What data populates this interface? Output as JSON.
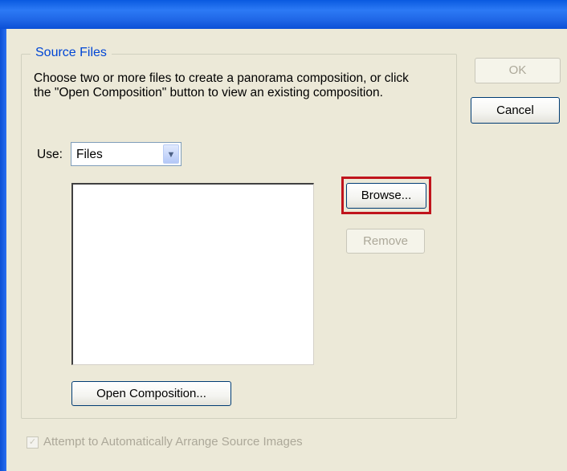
{
  "dialog": {
    "group_title": "Source Files",
    "description_line1": "Choose two or more files to create a panorama composition, or click",
    "description_line2": "the \"Open Composition\" button to view an existing composition.",
    "use_label": "Use:",
    "use_selected": "Files",
    "buttons": {
      "ok": "OK",
      "cancel": "Cancel",
      "browse": "Browse...",
      "remove": "Remove",
      "open_composition": "Open Composition..."
    },
    "checkbox": {
      "label": "Attempt to Automatically Arrange Source Images",
      "checked": true,
      "enabled": false
    }
  }
}
